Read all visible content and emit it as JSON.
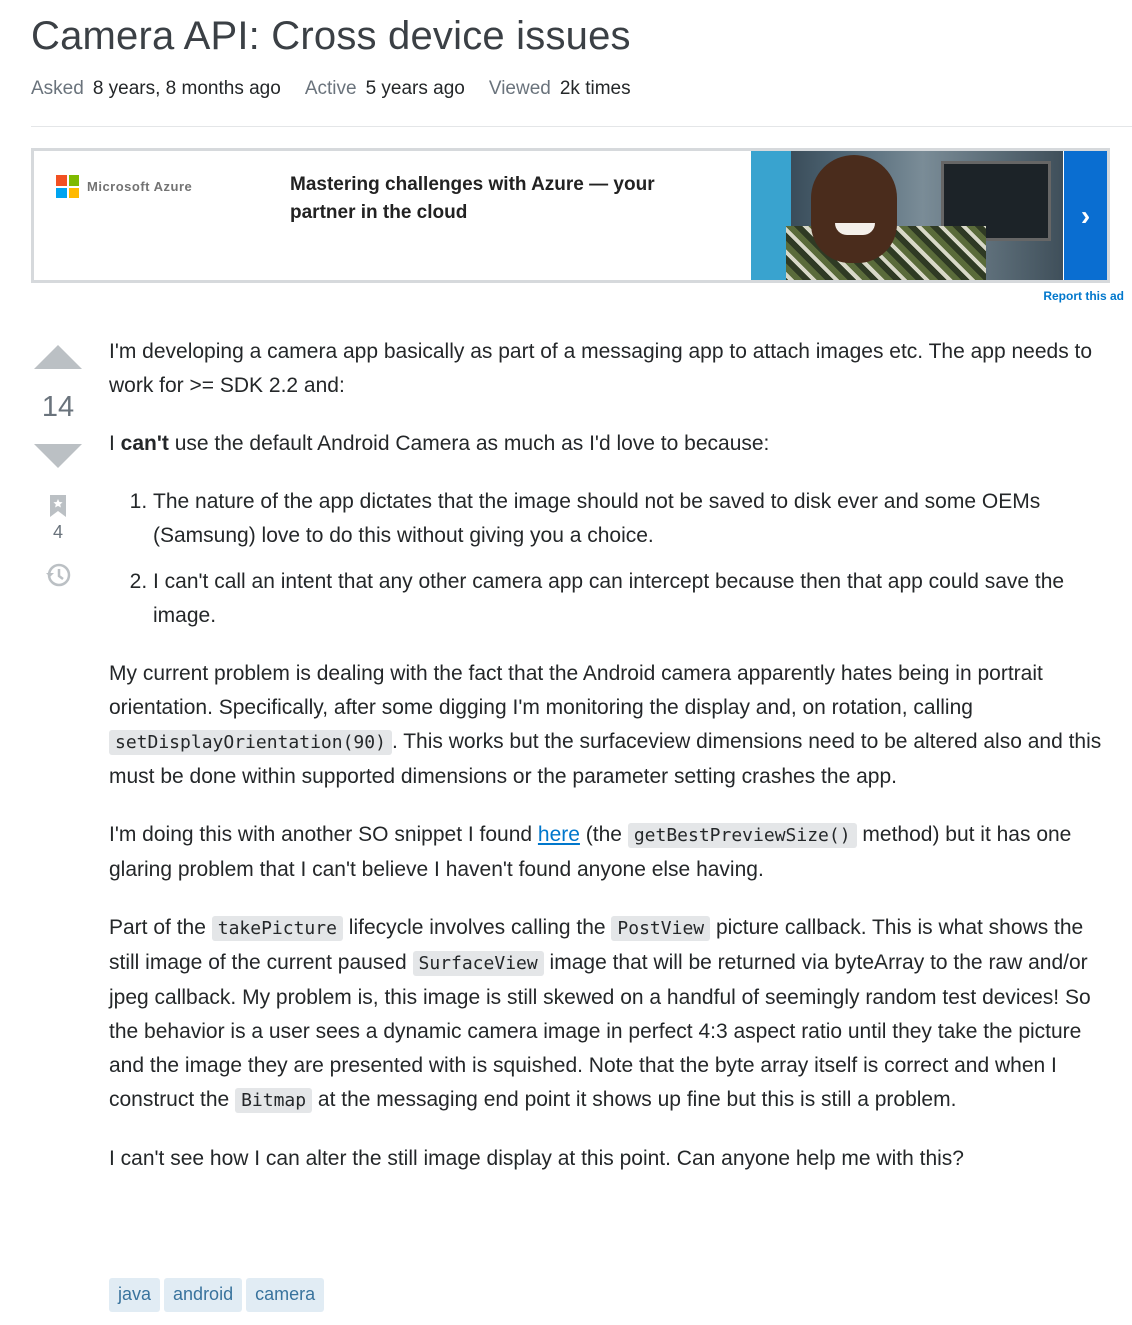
{
  "question": {
    "title": "Camera API: Cross device issues",
    "meta": {
      "asked_label": "Asked",
      "asked_value": "8 years, 8 months ago",
      "active_label": "Active",
      "active_value": "5 years ago",
      "viewed_label": "Viewed",
      "viewed_value": "2k times"
    },
    "votes": "14",
    "bookmarks": "4",
    "body": {
      "p1": "I'm developing a camera app basically as part of a messaging app to attach images etc. The app needs to work for >= SDK 2.2 and:",
      "p2_pre": "I ",
      "p2_bold": "can't",
      "p2_post": " use the default Android Camera as much as I'd love to because:",
      "list": [
        "The nature of the app dictates that the image should not be saved to disk ever and some OEMs (Samsung) love to do this without giving you a choice.",
        "I can't call an intent that any other camera app can intercept because then that app could save the image."
      ],
      "p3_a": "My current problem is dealing with the fact that the Android camera apparently hates being in portrait orientation. Specifically, after some digging I'm monitoring the display and, on rotation, calling ",
      "p3_code": "setDisplayOrientation(90)",
      "p3_b": ". This works but the surfaceview dimensions need to be altered also and this must be done within supported dimensions or the parameter setting crashes the app.",
      "p4_a": "I'm doing this with another SO snippet I found ",
      "p4_link": "here",
      "p4_b": " (the ",
      "p4_code": "getBestPreviewSize()",
      "p4_c": " method) but it has one glaring problem that I can't believe I haven't found anyone else having.",
      "p5_a": "Part of the ",
      "p5_code1": "takePicture",
      "p5_b": " lifecycle involves calling the ",
      "p5_code2": "PostView",
      "p5_c": " picture callback. This is what shows the still image of the current paused ",
      "p5_code3": "SurfaceView",
      "p5_d": " image that will be returned via byteArray to the raw and/or jpeg callback. My problem is, this image is still skewed on a handful of seemingly random test devices! So the behavior is a user sees a dynamic camera image in perfect 4:3 aspect ratio until they take the picture and the image they are presented with is squished. Note that the byte array itself is correct and when I construct the ",
      "p5_code4": "Bitmap",
      "p5_e": " at the messaging end point it shows up fine but this is still a problem.",
      "p6": "I can't see how I can alter the still image display at this point. Can anyone help me with this?"
    },
    "tags": [
      "java",
      "android",
      "camera"
    ]
  },
  "ad": {
    "brand": "Microsoft Azure",
    "headline": "Mastering challenges with Azure — your partner in the cloud",
    "arrow": "›",
    "report": "Report this ad"
  },
  "icons": {
    "upvote": "upvote-arrow-icon",
    "downvote": "downvote-arrow-icon",
    "bookmark": "bookmark-icon",
    "history": "history-icon"
  },
  "colors": {
    "link": "#0077cc",
    "tag_bg": "#e1ecf4",
    "tag_text": "#39739d",
    "vote_arrow": "#bbc0c4",
    "ad_button": "#0a6ed1"
  }
}
